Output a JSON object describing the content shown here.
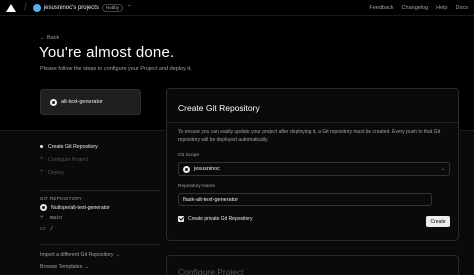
{
  "topbar": {
    "project": "jesusninoc's projects",
    "plan": "Hobby",
    "switcher": "⌃",
    "links": [
      "Feedback",
      "Changelog",
      "Help",
      "Docs"
    ]
  },
  "hero": {
    "back": "← Back",
    "title": "You're almost done.",
    "subtitle": "Please follow the steps to configure your Project and deploy it.",
    "repo_chip": "alt-text-generator"
  },
  "steps": [
    {
      "label": "Create Git Repository",
      "active": true
    },
    {
      "label": "Configure Project",
      "active": false
    },
    {
      "label": "Deploy",
      "active": false
    }
  ],
  "git": {
    "label": "GIT REPOSITORY",
    "repo": "Nutlope/alt-text-generator",
    "branch": "main",
    "dir": "/"
  },
  "links": {
    "import": "Import a different Git Repository →",
    "templates": "Browse Templates →"
  },
  "card": {
    "title": "Create Git Repository",
    "description": "To ensure you can easily update your project after deploying it, a Git repository must be created. Every push to that Git repository will be deployed automatically.",
    "scope_label": "Git Scope",
    "scope_value": "jesusninoc",
    "name_label": "Repository Name",
    "name_value": "flask-alt-text-generator",
    "private_label": "Create private Git Repository",
    "private_checked": true,
    "create_label": "Create"
  },
  "card2": {
    "title": "Configure Project"
  }
}
